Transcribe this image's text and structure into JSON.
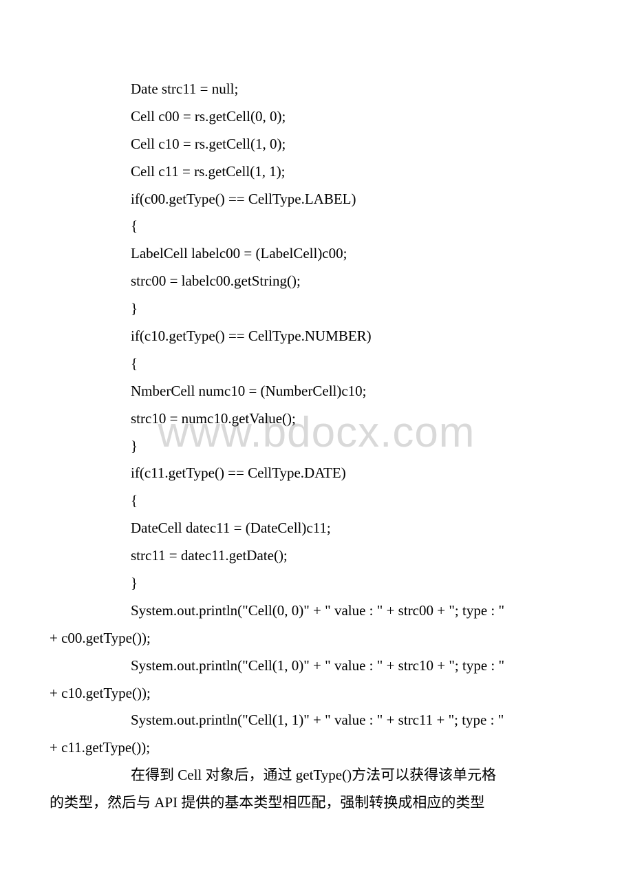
{
  "watermark": "www.bdocx.com",
  "lines": {
    "l1": "Date strc11 = null;",
    "l2": "Cell c00 = rs.getCell(0, 0);",
    "l3": "Cell c10 = rs.getCell(1, 0);",
    "l4": "Cell c11 = rs.getCell(1, 1);",
    "l5": "if(c00.getType() == CellType.LABEL)",
    "l6": "{",
    "l7": "LabelCell labelc00 = (LabelCell)c00;",
    "l8": "strc00 = labelc00.getString();",
    "l9": "}",
    "l10": "if(c10.getType() == CellType.NUMBER)",
    "l11": "{",
    "l12": "NmberCell numc10 = (NumberCell)c10;",
    "l13": "strc10 = numc10.getValue();",
    "l14": "}",
    "l15": "if(c11.getType() == CellType.DATE)",
    "l16": "{",
    "l17": "DateCell datec11 = (DateCell)c11;",
    "l18": "strc11 = datec11.getDate();",
    "l19": "}",
    "l20a": "System.out.println(\"Cell(0, 0)\" + \" value : \" + strc00 + \"; type : \"",
    "l20b": "+ c00.getType());",
    "l21a": "System.out.println(\"Cell(1, 0)\" + \" value : \" + strc10 + \"; type : \"",
    "l21b": "+ c10.getType());",
    "l22a": "System.out.println(\"Cell(1, 1)\" + \" value : \" + strc11 + \"; type : \"",
    "l22b": "+ c11.getType());",
    "p1a": "在得到 Cell 对象后，通过 getType()方法可以获得该单元格",
    "p1b": "的类型，然后与 API 提供的基本类型相匹配，强制转换成相应的类型"
  }
}
